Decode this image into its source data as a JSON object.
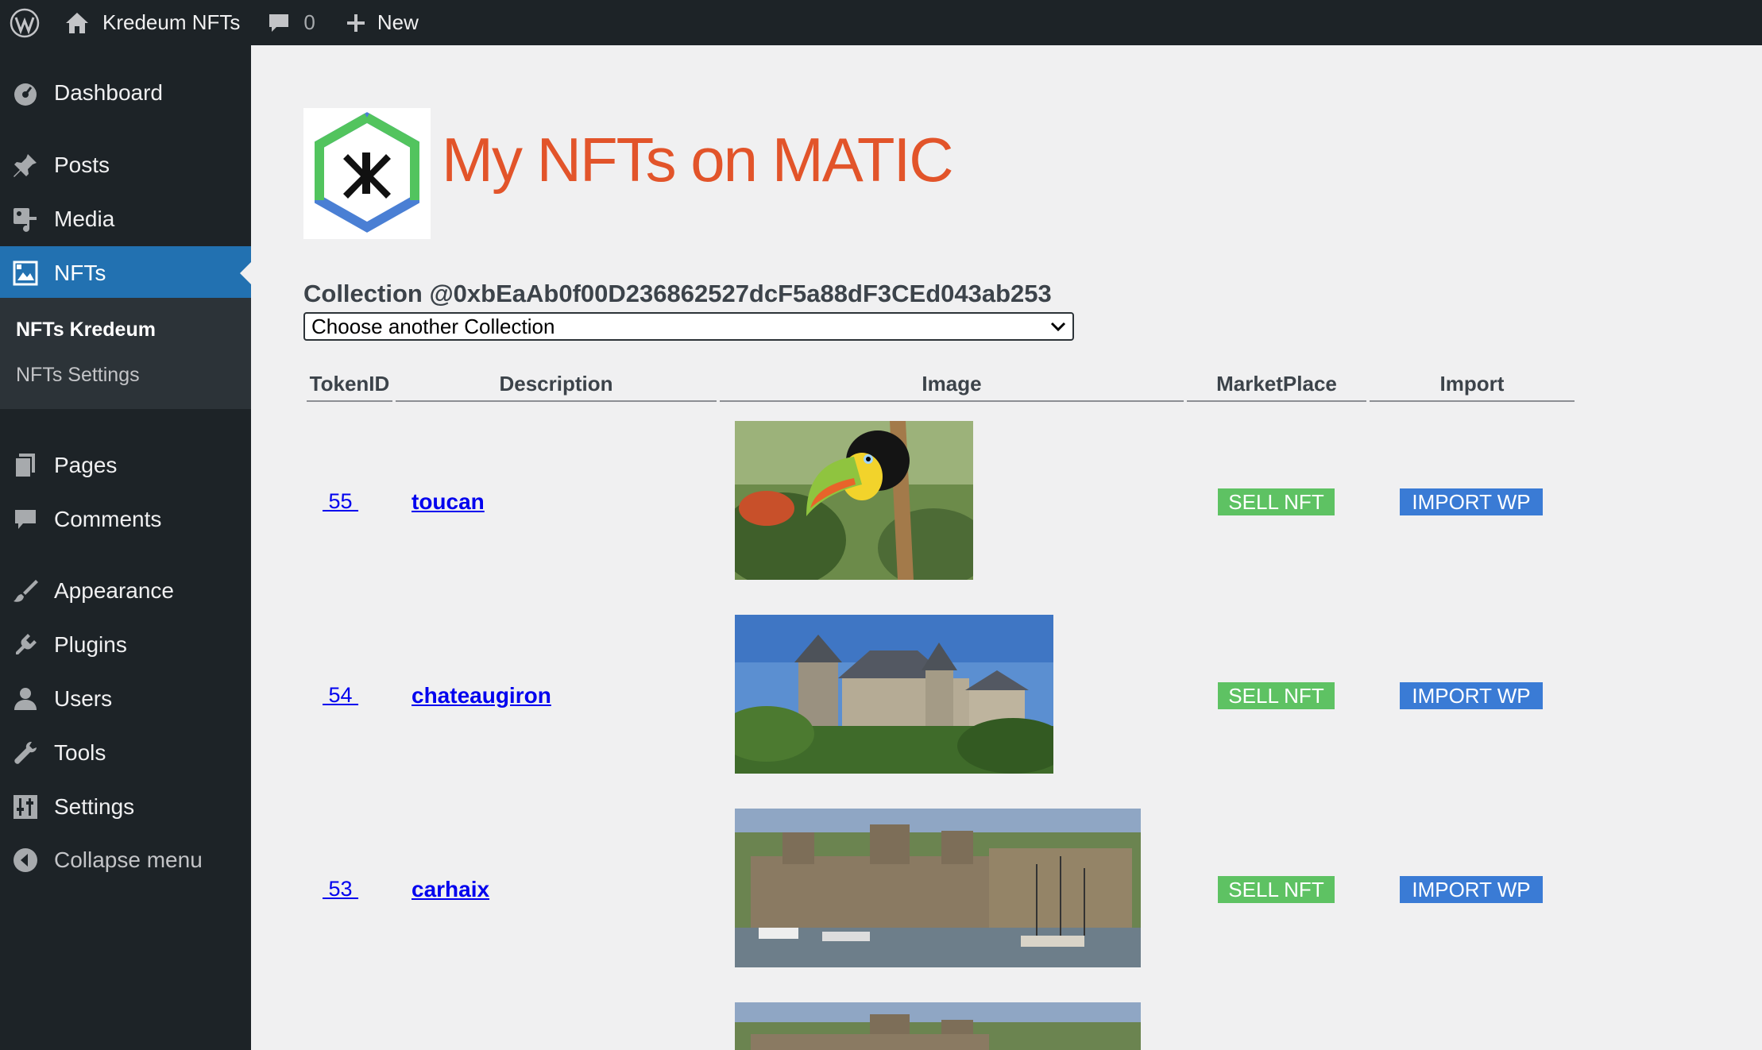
{
  "adminbar": {
    "site_name": "Kredeum NFTs",
    "comment_count": "0",
    "new_label": "New"
  },
  "sidebar": {
    "items": [
      {
        "label": "Dashboard",
        "icon": "dashboard-icon"
      },
      {
        "label": "Posts",
        "icon": "pin-icon"
      },
      {
        "label": "Media",
        "icon": "media-icon"
      },
      {
        "label": "NFTs",
        "icon": "gallery-icon",
        "current": true
      },
      {
        "label": "Pages",
        "icon": "pages-icon"
      },
      {
        "label": "Comments",
        "icon": "comment-icon"
      },
      {
        "label": "Appearance",
        "icon": "brush-icon"
      },
      {
        "label": "Plugins",
        "icon": "plugin-icon"
      },
      {
        "label": "Users",
        "icon": "user-icon"
      },
      {
        "label": "Tools",
        "icon": "wrench-icon"
      },
      {
        "label": "Settings",
        "icon": "settings-icon"
      }
    ],
    "submenu": [
      {
        "label": "NFTs Kredeum",
        "active": true
      },
      {
        "label": "NFTs Settings",
        "active": false
      }
    ],
    "collapse_label": "Collapse menu"
  },
  "main": {
    "title": "My NFTs on MATIC",
    "collection_title": "Collection @0xbEaAb0f00D236862527dcF5a88dF3CEd043ab253",
    "select_value": "Choose another Collection",
    "columns": [
      "TokenID",
      "Description",
      "Image",
      "MarketPlace",
      "Import"
    ],
    "rows": [
      {
        "token_id": " 55 ",
        "description": "toucan",
        "sell_label": "SELL NFT",
        "import_label": "IMPORT WP"
      },
      {
        "token_id": " 54 ",
        "description": "chateaugiron",
        "sell_label": "SELL NFT",
        "import_label": "IMPORT WP"
      },
      {
        "token_id": " 53 ",
        "description": "carhaix",
        "sell_label": "SELL NFT",
        "import_label": "IMPORT WP"
      }
    ]
  },
  "colors": {
    "adminbar": "#1d2327",
    "menu_current": "#2271b1",
    "title": "#e2542a",
    "sell_button": "#5ec263",
    "import_button": "#3a7bd5"
  }
}
